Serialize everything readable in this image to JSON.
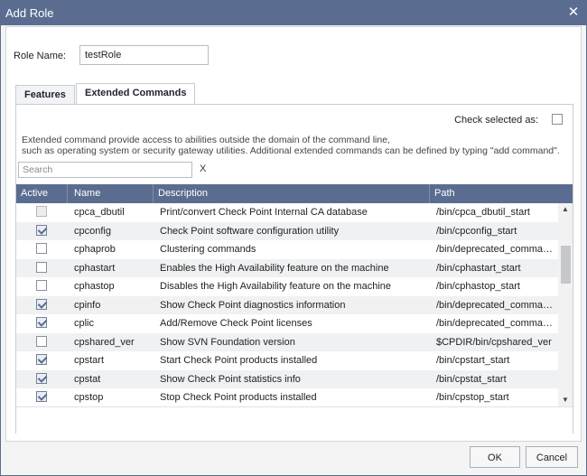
{
  "dialog": {
    "title": "Add Role",
    "close_glyph": "✕",
    "role_name_label": "Role Name:",
    "role_name_value": "testRole"
  },
  "tabs": [
    {
      "label": "Features",
      "active": false
    },
    {
      "label": "Extended Commands",
      "active": true
    }
  ],
  "panel": {
    "check_selected_label": "Check selected as:",
    "info_line1": "Extended command provide access to abilities outside the domain of the command line,",
    "info_line2": "such as operating system or security gateway utilities. Additional extended commands can be defined by typing \"add command\".",
    "search_placeholder": "Search",
    "clear_label": "X"
  },
  "table": {
    "columns": [
      "Active",
      "Name",
      "Description",
      "Path"
    ],
    "rows": [
      {
        "active": false,
        "disabled": true,
        "name": "cpca_dbutil",
        "description": "Print/convert Check Point Internal CA database",
        "path": "/bin/cpca_dbutil_start"
      },
      {
        "active": true,
        "disabled": false,
        "name": "cpconfig",
        "description": "Check Point software configuration utility",
        "path": "/bin/cpconfig_start"
      },
      {
        "active": false,
        "disabled": false,
        "name": "cphaprob",
        "description": "Clustering commands",
        "path": "/bin/deprecated_comman..."
      },
      {
        "active": false,
        "disabled": false,
        "name": "cphastart",
        "description": "Enables the High Availability feature on the machine",
        "path": "/bin/cphastart_start"
      },
      {
        "active": false,
        "disabled": false,
        "name": "cphastop",
        "description": "Disables the High Availability feature on the machine",
        "path": "/bin/cphastop_start"
      },
      {
        "active": true,
        "disabled": false,
        "name": "cpinfo",
        "description": "Show Check Point diagnostics information",
        "path": "/bin/deprecated_comman..."
      },
      {
        "active": true,
        "disabled": false,
        "name": "cplic",
        "description": "Add/Remove Check Point licenses",
        "path": "/bin/deprecated_comman..."
      },
      {
        "active": false,
        "disabled": false,
        "name": "cpshared_ver",
        "description": "Show SVN Foundation version",
        "path": "$CPDIR/bin/cpshared_ver"
      },
      {
        "active": true,
        "disabled": false,
        "name": "cpstart",
        "description": "Start Check Point products installed",
        "path": "/bin/cpstart_start"
      },
      {
        "active": true,
        "disabled": false,
        "name": "cpstat",
        "description": "Show Check Point statistics info",
        "path": "/bin/cpstat_start"
      },
      {
        "active": true,
        "disabled": false,
        "name": "cpstop",
        "description": "Stop Check Point products installed",
        "path": "/bin/cpstop_start"
      }
    ]
  },
  "buttons": {
    "ok": "OK",
    "cancel": "Cancel"
  },
  "scroll": {
    "up_glyph": "▲",
    "down_glyph": "▼"
  },
  "colors": {
    "titlebar": "#5a6d90",
    "header": "#5a6d90"
  }
}
